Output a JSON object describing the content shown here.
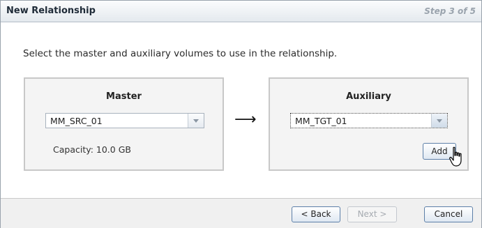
{
  "dialog": {
    "title": "New Relationship",
    "step": "Step 3 of 5"
  },
  "instruction": "Select the master and auxiliary volumes to use in the relationship.",
  "master": {
    "heading": "Master",
    "selected_volume": "MM_SRC_01",
    "capacity": "Capacity: 10.0 GB"
  },
  "auxiliary": {
    "heading": "Auxiliary",
    "selected_volume": "MM_TGT_01",
    "add_label": "Add"
  },
  "arrow_glyph": "⟶",
  "footer": {
    "back_label": "< Back",
    "next_label": "Next >",
    "cancel_label": "Cancel"
  },
  "icons": {
    "arrow": "right-arrow-icon",
    "dropdown": "chevron-down-icon",
    "cursor": "hand-pointer-icon"
  },
  "colors": {
    "button_border": "#5c7fa8",
    "panel_bg": "#f4f4f4",
    "disabled_text": "#a6abb1"
  }
}
